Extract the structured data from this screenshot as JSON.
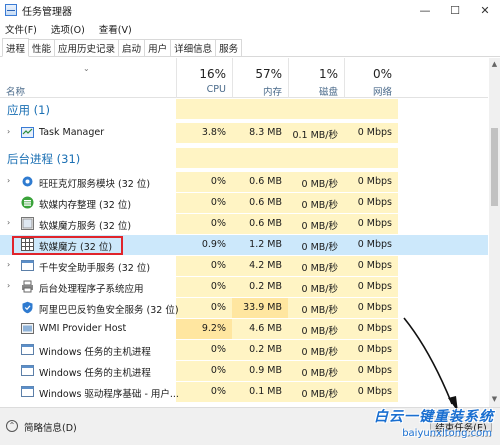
{
  "window": {
    "title": "任务管理器",
    "controls": {
      "minimize": "—",
      "maximize": "☐",
      "close": "✕"
    }
  },
  "menu": [
    "文件(F)",
    "选项(O)",
    "查看(V)"
  ],
  "tabs": [
    "进程",
    "性能",
    "应用历史记录",
    "启动",
    "用户",
    "详细信息",
    "服务"
  ],
  "active_tab": "进程",
  "columns": {
    "name": "名称",
    "cpu": {
      "percent": "16%",
      "label": "CPU"
    },
    "memory": {
      "percent": "57%",
      "label": "内存"
    },
    "disk": {
      "percent": "1%",
      "label": "磁盘"
    },
    "network": {
      "percent": "0%",
      "label": "网络"
    }
  },
  "sections": {
    "apps": "应用 (1)",
    "background": "后台进程 (31)"
  },
  "apps": [
    {
      "name": "Task Manager",
      "cpu": "3.8%",
      "memory": "8.3 MB",
      "disk": "0.1 MB/秒",
      "network": "0 Mbps",
      "expandable": true,
      "icon": "task-manager-icon"
    }
  ],
  "background": [
    {
      "name": "旺旺克灯服务模块 (32 位)",
      "cpu": "0%",
      "memory": "0.6 MB",
      "disk": "0 MB/秒",
      "network": "0 Mbps",
      "expandable": true,
      "icon": "gear-icon"
    },
    {
      "name": "软媒内存整理 (32 位)",
      "cpu": "0%",
      "memory": "0.6 MB",
      "disk": "0 MB/秒",
      "network": "0 Mbps",
      "expandable": false,
      "icon": "memory-cleaner-icon"
    },
    {
      "name": "软媒魔方服务 (32 位)",
      "cpu": "0%",
      "memory": "0.6 MB",
      "disk": "0 MB/秒",
      "network": "0 Mbps",
      "expandable": true,
      "icon": "cube-service-icon"
    },
    {
      "name": "软媒魔方 (32 位)",
      "cpu": "0.9%",
      "memory": "1.2 MB",
      "disk": "0 MB/秒",
      "network": "0 Mbps",
      "expandable": false,
      "icon": "grid-icon",
      "selected": true
    },
    {
      "name": "千牛安全助手服务 (32 位)",
      "cpu": "0%",
      "memory": "4.2 MB",
      "disk": "0 MB/秒",
      "network": "0 Mbps",
      "expandable": true,
      "icon": "window-icon"
    },
    {
      "name": "后台处理程序子系统应用",
      "cpu": "0%",
      "memory": "0.2 MB",
      "disk": "0 MB/秒",
      "network": "0 Mbps",
      "expandable": true,
      "icon": "printer-icon"
    },
    {
      "name": "阿里巴巴反钓鱼安全服务 (32 位)",
      "cpu": "0%",
      "memory": "33.9 MB",
      "disk": "0 MB/秒",
      "network": "0 Mbps",
      "expandable": false,
      "icon": "shield-icon"
    },
    {
      "name": "WMI Provider Host",
      "cpu": "9.2%",
      "memory": "4.6 MB",
      "disk": "0 MB/秒",
      "network": "0 Mbps",
      "expandable": false,
      "icon": "wmi-icon"
    },
    {
      "name": "Windows 任务的主机进程",
      "cpu": "0%",
      "memory": "0.2 MB",
      "disk": "0 MB/秒",
      "network": "0 Mbps",
      "expandable": false,
      "icon": "window-icon"
    },
    {
      "name": "Windows 任务的主机进程",
      "cpu": "0%",
      "memory": "0.9 MB",
      "disk": "0 MB/秒",
      "network": "0 Mbps",
      "expandable": false,
      "icon": "window-icon"
    },
    {
      "name": "Windows 驱动程序基础 - 用户...",
      "cpu": "0%",
      "memory": "0.1 MB",
      "disk": "0 MB/秒",
      "network": "0 Mbps",
      "expandable": false,
      "icon": "window-icon"
    }
  ],
  "footer": {
    "fewer_details": "简略信息(D)",
    "end_task": "结束任务(E)"
  },
  "watermark": {
    "main": "白云一键重装系统",
    "url": "baiyunxitong.com"
  },
  "colors": {
    "accent": "#1a6fb3",
    "selected_row": "#cce8fb",
    "heat_light": "#fff4c4",
    "heat_medium": "#ffe6a0",
    "highlight_border": "#e0242b"
  }
}
